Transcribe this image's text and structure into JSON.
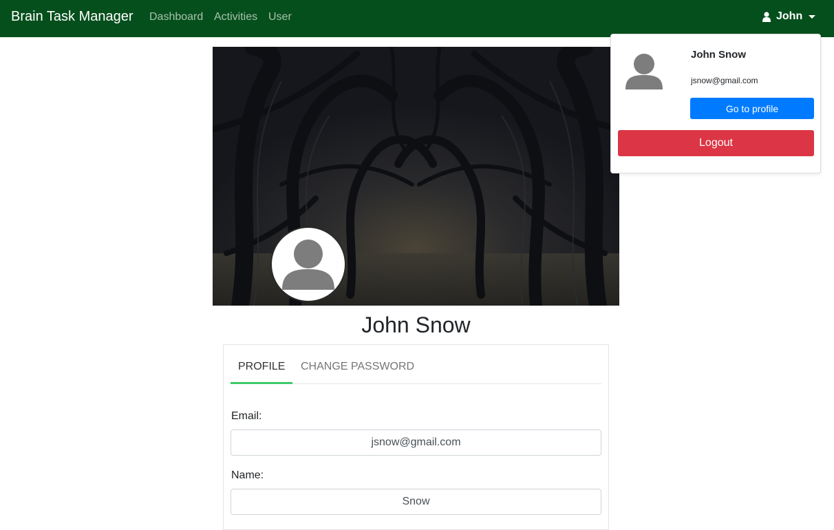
{
  "navbar": {
    "brand": "Brain Task Manager",
    "links": [
      "Dashboard",
      "Activities",
      "User"
    ],
    "user_label": "John"
  },
  "profile": {
    "name": "John Snow",
    "tabs": [
      "PROFILE",
      "CHANGE PASSWORD"
    ],
    "active_tab": "PROFILE",
    "email_label": "Email:",
    "email_value": "jsnow@gmail.com",
    "name_label": "Name:",
    "name_value": "Snow"
  },
  "dropdown": {
    "name": "John Snow",
    "email": "jsnow@gmail.com",
    "profile_button": "Go to profile",
    "logout_button": "Logout"
  },
  "colors": {
    "navbar": "#054f1c",
    "primary": "#007bff",
    "danger": "#dc3545",
    "tab_active": "#3ec96a"
  },
  "icons": [
    "user-icon",
    "caret-down-icon",
    "avatar-placeholder-icon"
  ]
}
